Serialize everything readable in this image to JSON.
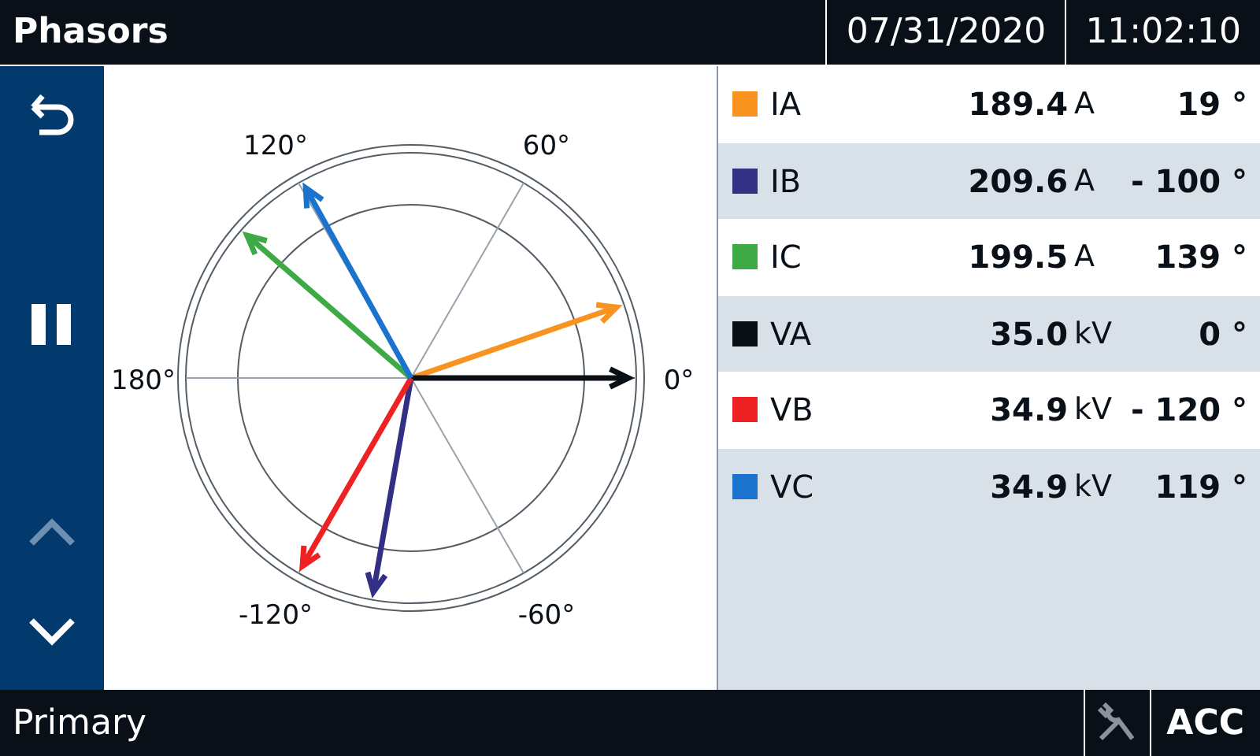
{
  "header": {
    "title": "Phasors",
    "date": "07/31/2020",
    "time": "11:02:10"
  },
  "sidebar": {
    "buttons": [
      {
        "kind": "back",
        "disabled": false
      },
      {
        "kind": "pause",
        "disabled": false
      },
      {
        "kind": "up",
        "disabled": true
      },
      {
        "kind": "down",
        "disabled": false
      }
    ]
  },
  "diagram": {
    "angle_labels": [
      "0°",
      "60°",
      "120°",
      "180°",
      "-120°",
      "-60°"
    ]
  },
  "phasors": [
    {
      "name": "IA",
      "color": "#f7931e",
      "value": "189.4",
      "unit": "A",
      "angle": "19 °"
    },
    {
      "name": "IB",
      "color": "#332f85",
      "value": "209.6",
      "unit": "A",
      "angle": "- 100 °"
    },
    {
      "name": "IC",
      "color": "#3eaa45",
      "value": "199.5",
      "unit": "A",
      "angle": "139 °"
    },
    {
      "name": "VA",
      "color": "#0a0f16",
      "value": "35.0",
      "unit": "kV",
      "angle": "0 °"
    },
    {
      "name": "VB",
      "color": "#ee2222",
      "value": "34.9",
      "unit": "kV",
      "angle": "- 120 °"
    },
    {
      "name": "VC",
      "color": "#1a73cc",
      "value": "34.9",
      "unit": "kV",
      "angle": "119 °"
    }
  ],
  "status_bar": {
    "mode": "Primary",
    "tools_enabled": false,
    "badge": "ACC"
  }
}
